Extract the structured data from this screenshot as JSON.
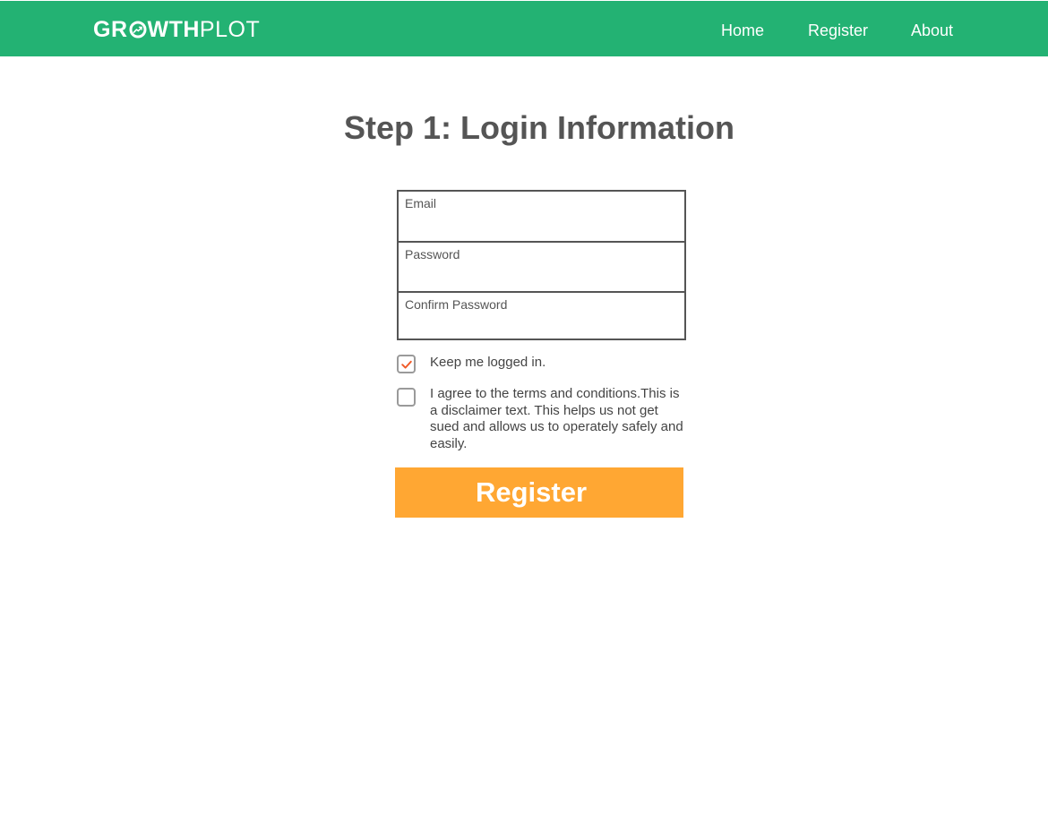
{
  "brand": {
    "name_bold": "GR",
    "name_bold_rest": "WTH",
    "name_light": "PLOT",
    "icon": "trend-arrow-circle-icon"
  },
  "nav": {
    "items": [
      {
        "label": "Home"
      },
      {
        "label": "Register"
      },
      {
        "label": "About"
      }
    ]
  },
  "page": {
    "title": "Step 1: Login Information"
  },
  "form": {
    "fields": [
      {
        "label": "Email",
        "value": ""
      },
      {
        "label": "Password",
        "value": ""
      },
      {
        "label": "Confirm Password",
        "value": ""
      }
    ],
    "checkboxes": [
      {
        "label": "Keep me logged in.",
        "checked": true,
        "icon": "checkmark-icon"
      },
      {
        "label": "I agree to the terms and conditions.This is a disclaimer text. This helps us not get sued and allows us to operately safely and easily.",
        "checked": false
      }
    ],
    "submit_label": "Register"
  },
  "colors": {
    "navbar": "#23b273",
    "button": "#ffa733",
    "check": "#f05a28",
    "text": "#555555"
  }
}
